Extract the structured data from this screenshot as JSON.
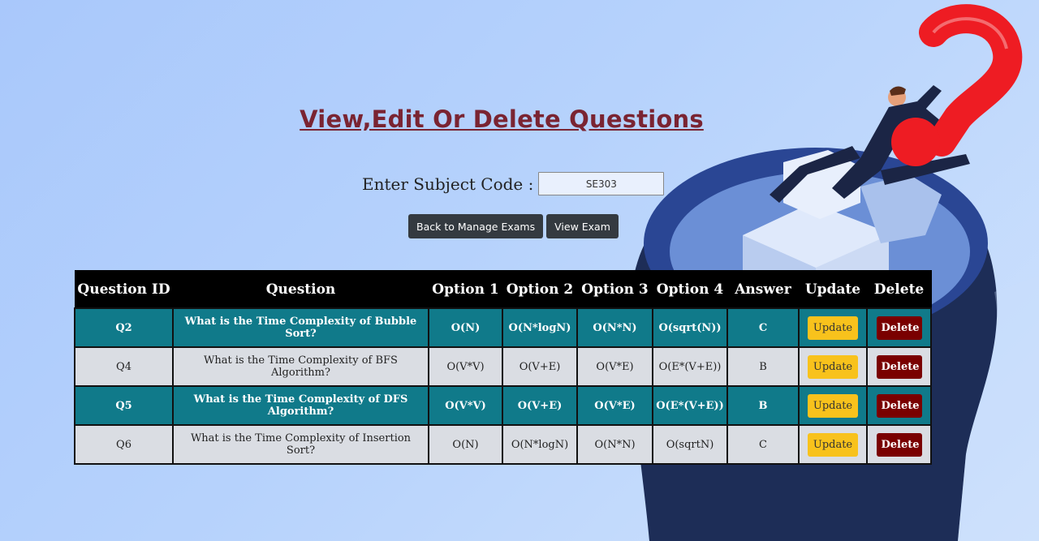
{
  "page": {
    "title": "View,Edit Or Delete Questions"
  },
  "subject": {
    "label": "Enter Subject Code :",
    "value": "SE303"
  },
  "buttons": {
    "back": "Back to Manage Exams",
    "view": "View Exam"
  },
  "table": {
    "headers": [
      "Question ID",
      "Question",
      "Option 1",
      "Option 2",
      "Option 3",
      "Option 4",
      "Answer",
      "Update",
      "Delete"
    ],
    "rows": [
      {
        "id": "Q2",
        "question": "What is the Time Complexity of Bubble Sort?",
        "opt1": "O(N)",
        "opt2": "O(N*logN)",
        "opt3": "O(N*N)",
        "opt4": "O(sqrt(N))",
        "answer": "C",
        "update": "Update",
        "delete": "Delete"
      },
      {
        "id": "Q4",
        "question": "What is the Time Complexity of BFS Algorithm?",
        "opt1": "O(V*V)",
        "opt2": "O(V+E)",
        "opt3": "O(V*E)",
        "opt4": "O(E*(V+E))",
        "answer": "B",
        "update": "Update",
        "delete": "Delete"
      },
      {
        "id": "Q5",
        "question": "What is the Time Complexity of DFS Algorithm?",
        "opt1": "O(V*V)",
        "opt2": "O(V+E)",
        "opt3": "O(V*E)",
        "opt4": "O(E*(V+E))",
        "answer": "B",
        "update": "Update",
        "delete": "Delete"
      },
      {
        "id": "Q6",
        "question": "What is the Time Complexity of Insertion Sort?",
        "opt1": "O(N)",
        "opt2": "O(N*logN)",
        "opt3": "O(N*N)",
        "opt4": "O(sqrtN)",
        "answer": "C",
        "update": "Update",
        "delete": "Delete"
      }
    ]
  }
}
